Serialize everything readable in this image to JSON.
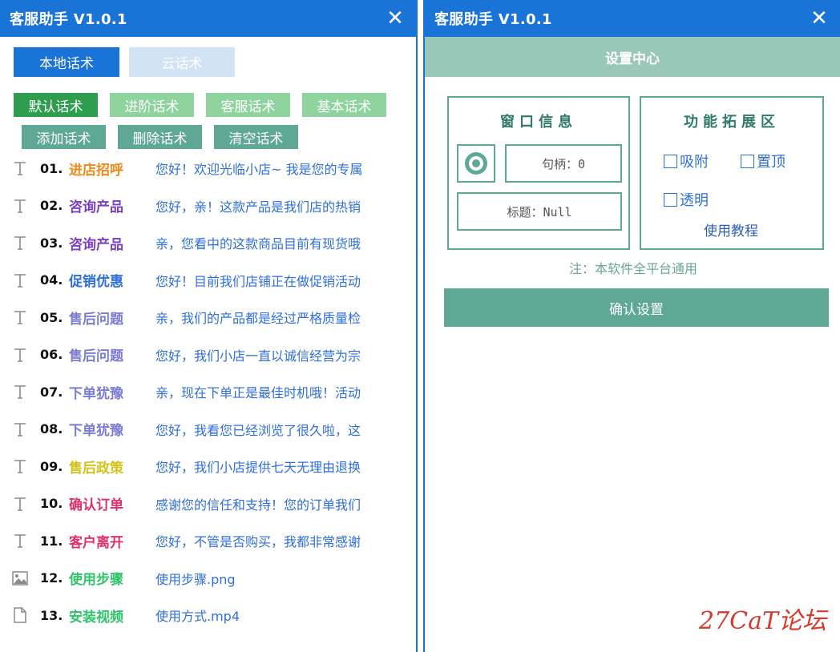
{
  "left_window": {
    "title": "客服助手 V1.0.1",
    "close_glyph": "✕",
    "tabs": [
      {
        "label": "本地话术",
        "active": true
      },
      {
        "label": "云话术",
        "active": false
      }
    ],
    "buttons": [
      {
        "label": "默认话术",
        "color": "#2e9e4e"
      },
      {
        "label": "进阶话术",
        "color": "#8fd39e"
      },
      {
        "label": "客服话术",
        "color": "#8fd39e"
      },
      {
        "label": "基本话术",
        "color": "#8fd39e"
      },
      {
        "label": "添加话术",
        "color": "#5fa896"
      },
      {
        "label": "删除话术",
        "color": "#5fa896"
      },
      {
        "label": "清空话术",
        "color": "#5fa896"
      }
    ],
    "items": [
      {
        "icon": "text-icon",
        "num": "01.",
        "category": "进店招呼",
        "color": "#f08a18",
        "text": "您好！欢迎光临小店~ 我是您的专属"
      },
      {
        "icon": "text-icon",
        "num": "02.",
        "category": "咨询产品",
        "color": "#7b3fc4",
        "text": "您好，亲！这款产品是我们店的热销"
      },
      {
        "icon": "text-icon",
        "num": "03.",
        "category": "咨询产品",
        "color": "#7b3fc4",
        "text": "亲，您看中的这款商品目前有现货哦"
      },
      {
        "icon": "text-icon",
        "num": "04.",
        "category": "促销优惠",
        "color": "#2f6fd8",
        "text": "您好！目前我们店铺正在做促销活动"
      },
      {
        "icon": "text-icon",
        "num": "05.",
        "category": "售后问题",
        "color": "#7b7bd4",
        "text": "亲，我们的产品都是经过严格质量检"
      },
      {
        "icon": "text-icon",
        "num": "06.",
        "category": "售后问题",
        "color": "#7b7bd4",
        "text": "您好，我们小店一直以诚信经营为宗"
      },
      {
        "icon": "text-icon",
        "num": "07.",
        "category": "下单犹豫",
        "color": "#7b7bd4",
        "text": "亲，现在下单正是最佳时机哦！活动"
      },
      {
        "icon": "text-icon",
        "num": "08.",
        "category": "下单犹豫",
        "color": "#7b7bd4",
        "text": "您好，我看您已经浏览了很久啦，这"
      },
      {
        "icon": "text-icon",
        "num": "09.",
        "category": "售后政策",
        "color": "#d4c21a",
        "text": "您好，我们小店提供七天无理由退换"
      },
      {
        "icon": "text-icon",
        "num": "10.",
        "category": "确认订单",
        "color": "#e0306a",
        "text": "感谢您的信任和支持！您的订单我们"
      },
      {
        "icon": "text-icon",
        "num": "11.",
        "category": "客户离开",
        "color": "#e0306a",
        "text": "您好，不管是否购买，我都非常感谢"
      },
      {
        "icon": "image-icon",
        "num": "12.",
        "category": "使用步骤",
        "color": "#2ec46a",
        "text": "使用步骤.png"
      },
      {
        "icon": "file-icon",
        "num": "13.",
        "category": "安装视频",
        "color": "#2ec46a",
        "text": "使用方式.mp4"
      }
    ]
  },
  "right_window": {
    "title": "客服助手 V1.0.1",
    "close_glyph": "✕",
    "settings_header": "设置中心",
    "window_info": {
      "title": "窗口信息",
      "handle": "句柄：0",
      "caption": "标题：Null"
    },
    "features": {
      "title": "功能拓展区",
      "options": [
        {
          "label": "吸附",
          "checked": false
        },
        {
          "label": "置顶",
          "checked": false
        },
        {
          "label": "透明",
          "checked": false
        }
      ],
      "tutorial_link": "使用教程"
    },
    "note": "注：本软件全平台通用",
    "confirm_label": "确认设置"
  },
  "watermark": "27CaT论坛",
  "colors": {
    "titlebar": "#1a73d6",
    "accent_green": "#5fa896",
    "settings_header_bg": "#99c7b8"
  }
}
